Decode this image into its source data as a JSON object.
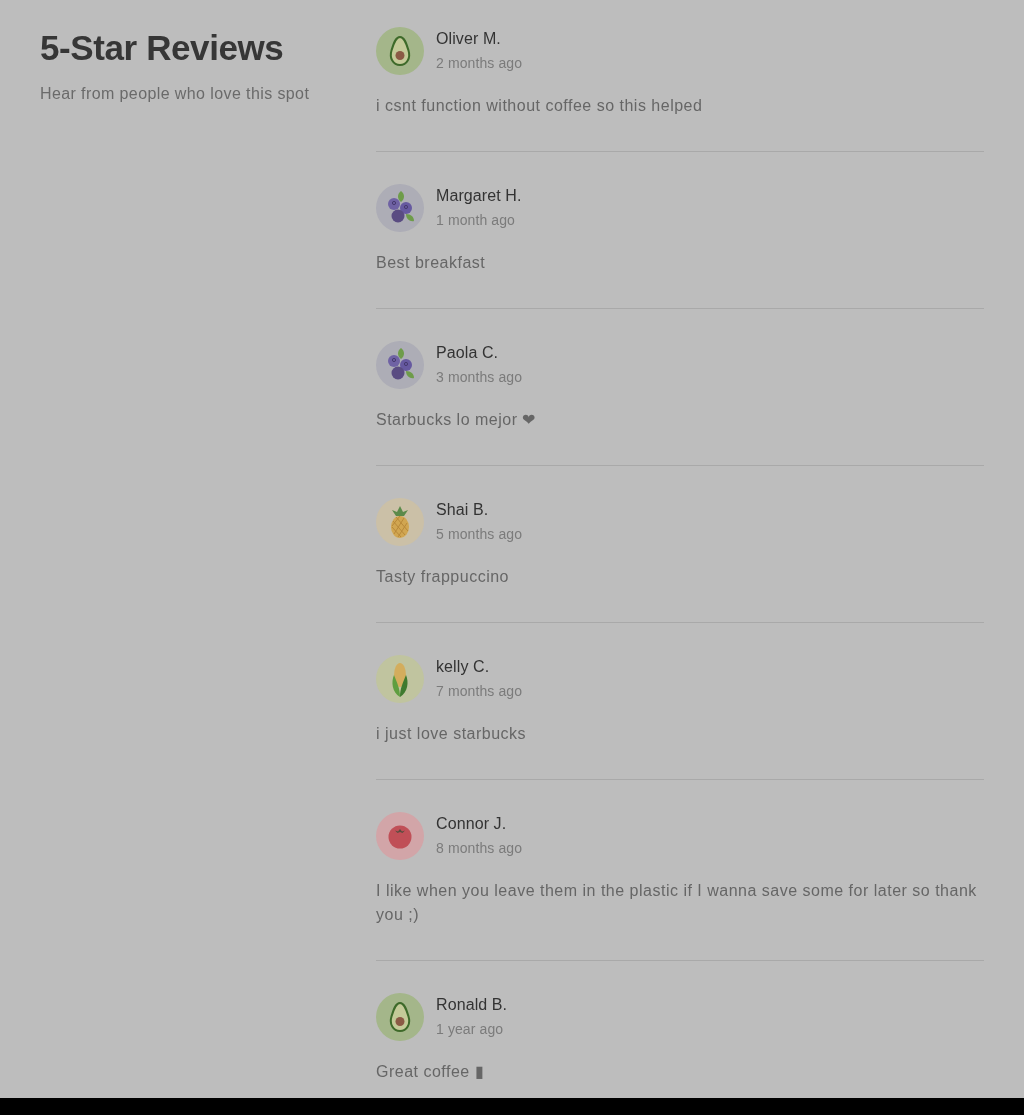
{
  "header": {
    "title": "5-Star Reviews",
    "subtitle": "Hear from people who love this spot"
  },
  "reviews": [
    {
      "name": "Oliver M.",
      "time": "2 months ago",
      "avatar": {
        "kind": "avocado"
      },
      "text": "i csnt function without coffee so this helped"
    },
    {
      "name": "Margaret H.",
      "time": "1 month ago",
      "avatar": {
        "kind": "blueberries"
      },
      "text": "Best breakfast"
    },
    {
      "name": "Paola C.",
      "time": "3 months ago",
      "avatar": {
        "kind": "blueberries"
      },
      "text": "Starbucks lo mejor ❤"
    },
    {
      "name": "Shai B.",
      "time": "5 months ago",
      "avatar": {
        "kind": "pineapple"
      },
      "text": "Tasty frappuccino"
    },
    {
      "name": "kelly C.",
      "time": "7 months ago",
      "avatar": {
        "kind": "corn"
      },
      "text": "i just love starbucks"
    },
    {
      "name": "Connor J.",
      "time": "8 months ago",
      "avatar": {
        "kind": "tomato"
      },
      "text": "I like when you leave them in the plastic if I wanna save some for later so thank you ;)"
    },
    {
      "name": "Ronald B.",
      "time": "1 year ago",
      "avatar": {
        "kind": "avocado"
      },
      "text": "Great coffee ▮"
    }
  ]
}
